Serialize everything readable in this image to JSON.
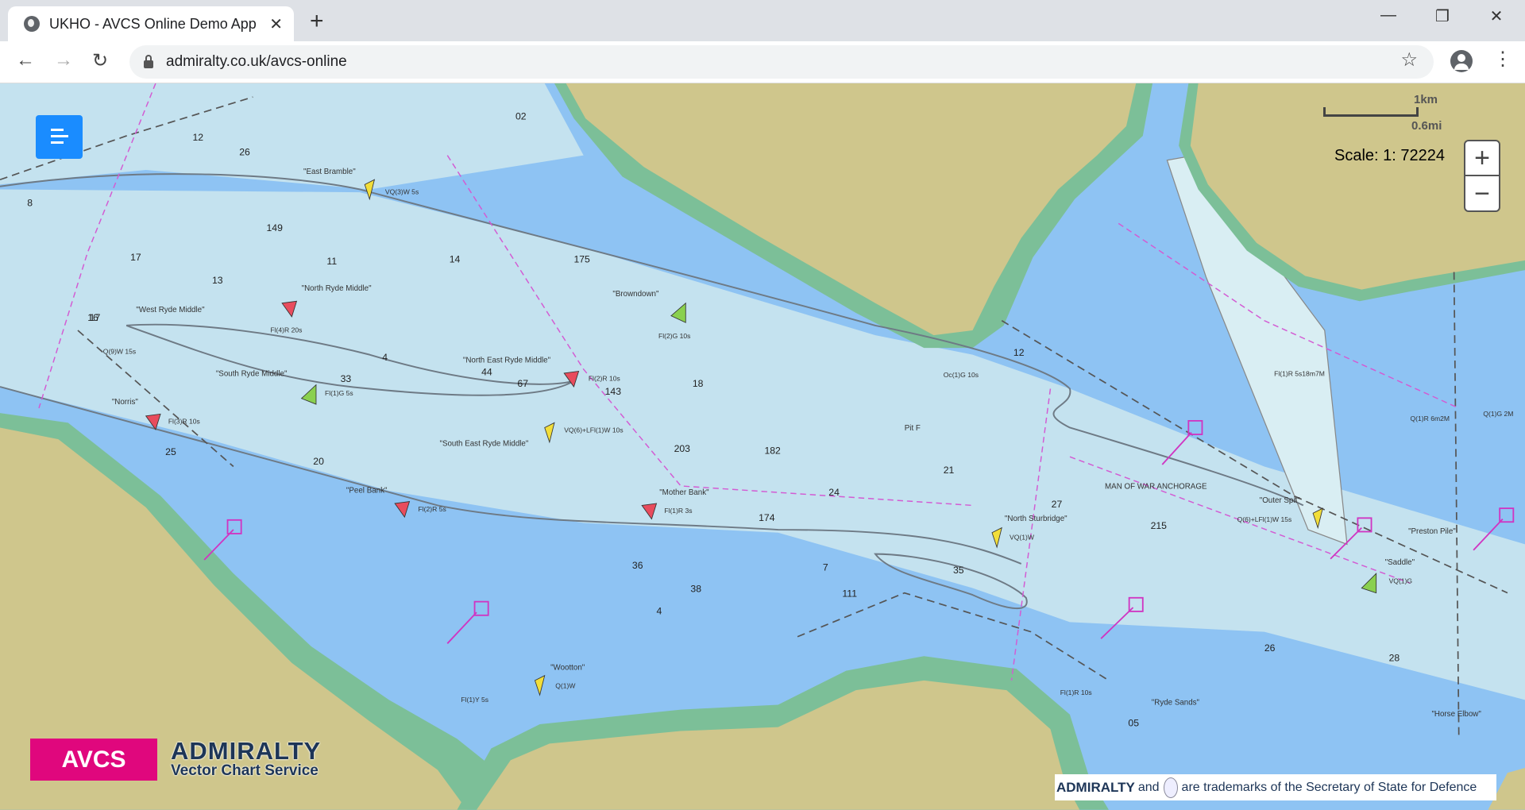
{
  "browser": {
    "tab_title": "UKHO - AVCS Online Demo App",
    "tab_close": "✕",
    "new_tab": "+",
    "url": "admiralty.co.uk/avcs-online",
    "back": "←",
    "forward": "→",
    "reload": "↻",
    "bookmark": "☆",
    "more": "⋮",
    "minimize": "—",
    "restore": "❐",
    "close": "✕"
  },
  "map": {
    "scale_km": "1km",
    "scale_mi": "0.6mi",
    "scale_text": "Scale: 1: 72224",
    "zoom_in": "+",
    "zoom_out": "−",
    "colors": {
      "deep": "#8ec3f3",
      "shallow": "#c4e2ef",
      "land": "#cfc68c",
      "intertidal": "#7cbf98",
      "menu": "#1a8cff"
    },
    "place_names": [
      "\"North Ryde Middle\"",
      "\"West Ryde Middle\"",
      "\"South Ryde Middle\"",
      "\"North East Ryde Middle\"",
      "\"South East Ryde Middle\"",
      "\"Browndown\"",
      "\"Peel Bank\"",
      "\"Mother Bank\"",
      "\"Wootton\"",
      "MAN OF WAR ANCHORAGE",
      "\"North Sturbridge\"",
      "\"Outer Spit\"",
      "\"Preston Pile\"",
      "\"Saddle\"",
      "\"Ryde Sands\"",
      "\"Horse Elbow\"",
      "\"East Bramble\"",
      "\"Norris\"",
      "Pit F"
    ],
    "lights": [
      "Fl(4)R 20s",
      "VQ(3)W 5s",
      "Fl(2)G 10s",
      "Fl(2)R 10s",
      "VQ(6)+LFl(1)W 10s",
      "Fl(3)R 10s",
      "Fl(2)R 5s",
      "Fl(1)R 3s",
      "Oc(1)G 10s",
      "Q(9)W 15s",
      "Fl(1)G 5s",
      "VQ(1)W",
      "Q(1)W",
      "Fl(1)Y 5s",
      "Fl(1)R 10s",
      "Q(6)+LFl(1)W 15s",
      "Fl(1)R 5s18m7M",
      "Q(1)R 6m2M",
      "Q(1)G 2M",
      "VQ(1)G"
    ],
    "soundings": [
      "12",
      "26",
      "17",
      "149",
      "11",
      "13",
      "14",
      "175",
      "8",
      "17",
      "16",
      "20",
      "4",
      "33",
      "44",
      "67",
      "18",
      "143",
      "203",
      "182",
      "21",
      "24",
      "174",
      "7",
      "111",
      "35",
      "27",
      "215",
      "25",
      "28",
      "26",
      "12",
      "05",
      "02",
      "36",
      "38",
      "4"
    ]
  },
  "branding": {
    "avcs": "AVCS",
    "admiralty": "ADMIRALTY",
    "subtitle": "Vector Chart Service",
    "trademark_bold": "ADMIRALTY",
    "trademark_and": "and",
    "trademark_rest": "are trademarks of the Secretary of State for Defence"
  }
}
